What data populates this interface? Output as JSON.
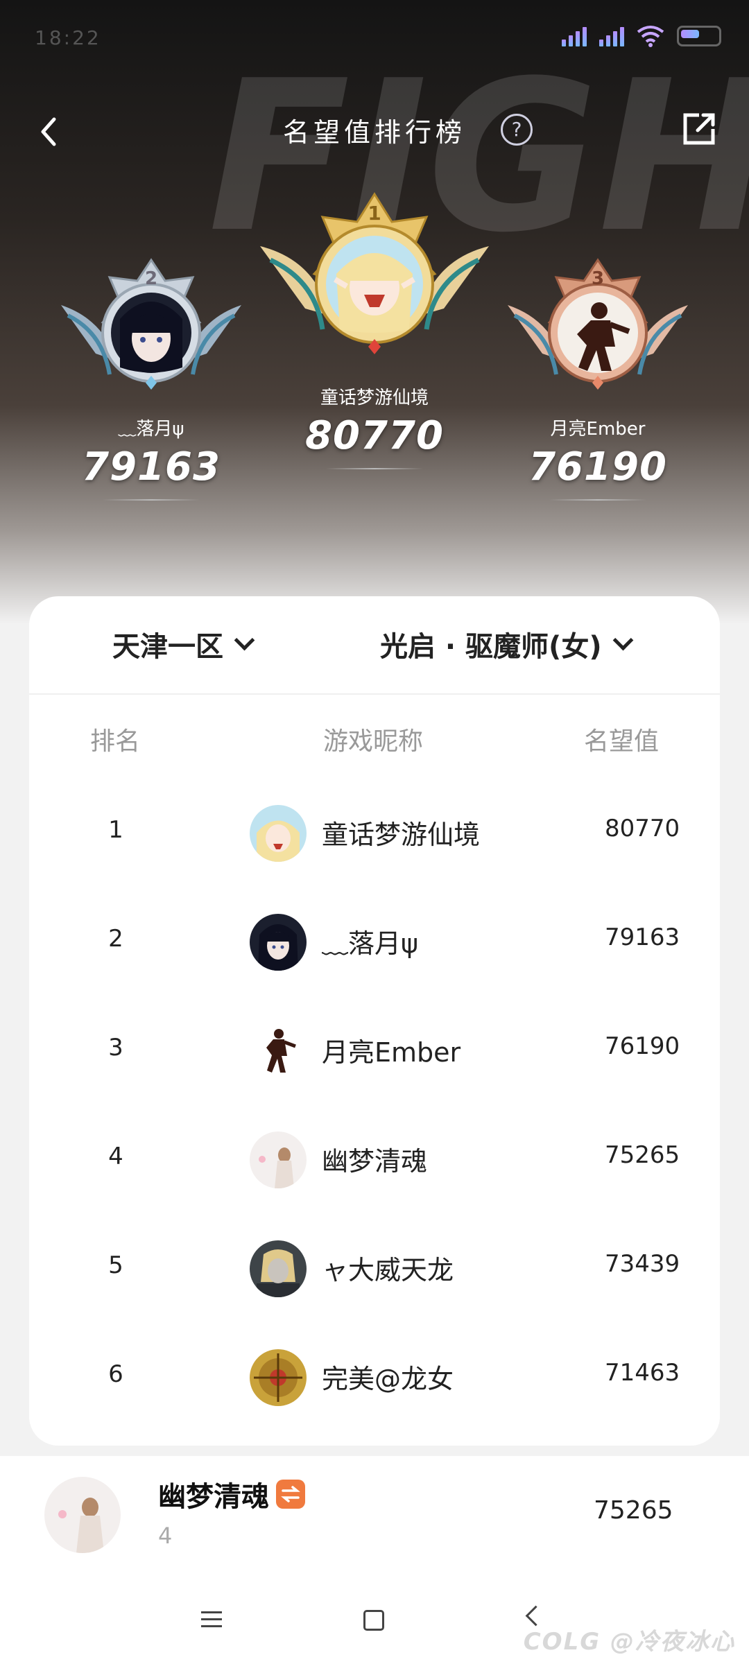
{
  "status_bar": {
    "time": "18:22"
  },
  "header": {
    "title": "名望值排行榜",
    "help_icon": "question-circle-icon",
    "share_icon": "share-icon",
    "back_icon": "back-chevron-icon"
  },
  "podium": [
    {
      "rank": "1",
      "name": "童话梦游仙境",
      "score": "80770",
      "medal": "gold"
    },
    {
      "rank": "2",
      "name": "﹏落月ψ",
      "score": "79163",
      "medal": "silver"
    },
    {
      "rank": "3",
      "name": "月亮Ember",
      "score": "76190",
      "medal": "bronze"
    }
  ],
  "filters": {
    "server": "天津一区",
    "class": "光启 · 驱魔师(女)"
  },
  "table": {
    "headers": {
      "rank": "排名",
      "name": "游戏昵称",
      "score": "名望值"
    },
    "rows": [
      {
        "rank": "1",
        "name": "童话梦游仙境",
        "score": "80770"
      },
      {
        "rank": "2",
        "name": "﹏落月ψ",
        "score": "79163"
      },
      {
        "rank": "3",
        "name": "月亮Ember",
        "score": "76190"
      },
      {
        "rank": "4",
        "name": "幽梦清魂",
        "score": "75265"
      },
      {
        "rank": "5",
        "name": "ャ大威天龙",
        "score": "73439"
      },
      {
        "rank": "6",
        "name": "完美@龙女",
        "score": "71463"
      }
    ]
  },
  "me": {
    "name": "幽梦清魂",
    "rank": "4",
    "score": "75265",
    "tag_icon": "swap-arrows-icon"
  },
  "watermark": "COLG @冷夜冰心",
  "colors": {
    "gold": "#e8c46a",
    "silver": "#c9d2dc",
    "bronze": "#d89a7c",
    "tag": "#f07a3e"
  }
}
